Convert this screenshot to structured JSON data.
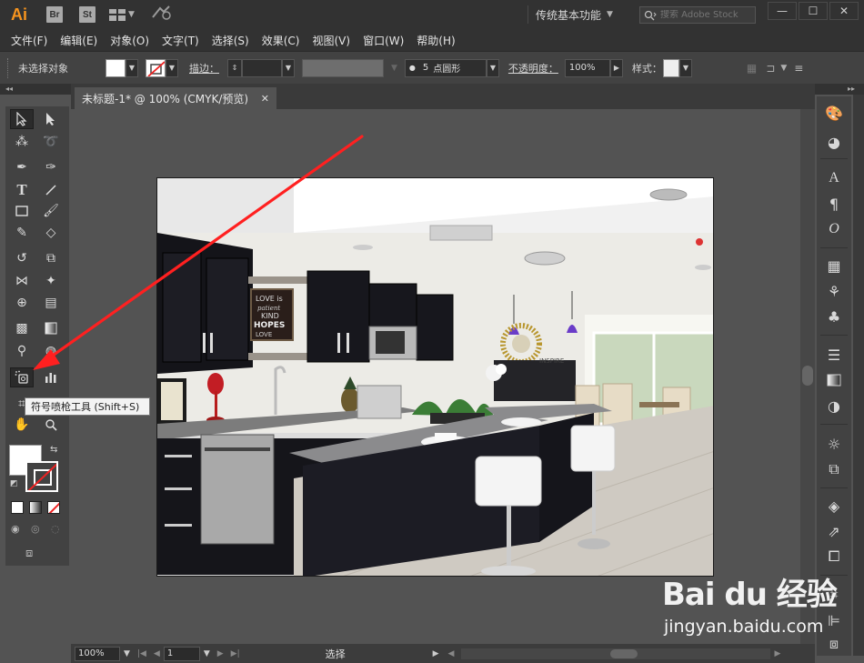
{
  "title_bar": {
    "logo": "Ai",
    "bridge": "Br",
    "stock": "St",
    "workspace": "传统基本功能",
    "stock_search_placeholder": "搜索 Adobe Stock",
    "minimize": "—",
    "maximize": "☐",
    "close": "✕"
  },
  "menu": {
    "items": [
      "文件(F)",
      "编辑(E)",
      "对象(O)",
      "文字(T)",
      "选择(S)",
      "效果(C)",
      "视图(V)",
      "窗口(W)",
      "帮助(H)"
    ]
  },
  "control_bar": {
    "selection_status": "未选择对象",
    "stroke_label": "描边：",
    "brush_size": "5",
    "brush_shape": "点圆形",
    "opacity_label": "不透明度：",
    "opacity_value": "100%",
    "style_label": "样式："
  },
  "document": {
    "tab_title": "未标题-1* @ 100% (CMYK/预览)",
    "tab_close": "✕"
  },
  "artwork": {
    "sign_text": [
      "LOVE is",
      "patient",
      "KIND",
      "HOPES",
      "LOVE"
    ],
    "brand": "INSPIRE"
  },
  "tooltip": {
    "text": "符号喷枪工具 (Shift+S)"
  },
  "status_bar": {
    "zoom": "100%",
    "page": "1",
    "mode": "选择"
  },
  "watermark": {
    "brand": "Bai du 经验",
    "url": "jingyan.baidu.com"
  },
  "colors": {
    "app_bg": "#535353",
    "chrome_dark": "#323232",
    "panel": "#424242",
    "arrow": "#ff2020",
    "ai_orange": "#f7941e"
  }
}
